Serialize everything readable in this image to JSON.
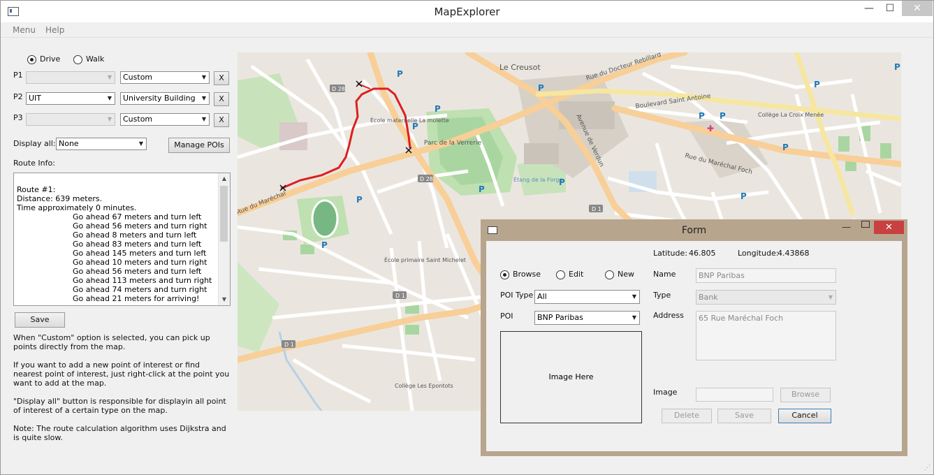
{
  "window": {
    "title": "MapExplorer",
    "minimize": "—",
    "maximize": "☐",
    "close": "✕"
  },
  "menubar": {
    "items": [
      "Menu",
      "Help"
    ]
  },
  "mode": {
    "options": [
      "Drive",
      "Walk"
    ],
    "selected": "Drive"
  },
  "points": [
    {
      "label": "P1",
      "place": "",
      "type": "Custom",
      "remove": "X"
    },
    {
      "label": "P2",
      "place": "UIT",
      "type": "University Building",
      "remove": "X"
    },
    {
      "label": "P3",
      "place": "",
      "type": "Custom",
      "remove": "X"
    }
  ],
  "display_all": {
    "label": "Display all:",
    "value": "None"
  },
  "manage_pois_label": "Manage POIs",
  "route_info": {
    "label": "Route Info:",
    "lines": [
      "Route #1:",
      "Distance: 639 meters.",
      "Time approximately 0 minutes.",
      "Go ahead 67 meters and turn left",
      "Go ahead 56 meters and turn right",
      "Go ahead 8 meters and turn left",
      "Go ahead 83 meters and turn left",
      "Go ahead 145 meters and turn left",
      "Go ahead 10 meters and turn right",
      "Go ahead 56 meters and turn left",
      "Go ahead 113 meters and turn right",
      "Go ahead 74 meters and turn right",
      "Go ahead 21 meters for arriving!"
    ]
  },
  "save_label": "Save",
  "help": [
    "When \"Custom\" option is selected, you can pick up points directly from the map.",
    "If you want to add a new point of interest or find nearest point of interest, just right-click at the point you want to add at the map.",
    " \"Display all\" button is responsible for displayin all point of interest of a certain type on the map.",
    "Note: The route calculation algorithm uses Dijkstra and is quite slow."
  ],
  "map_labels": {
    "le_creusot": "Le Creusot",
    "parc": "Parc de la Verrerie",
    "ecole_maternelle": "École maternelle La molette",
    "ecole_primaire": "École primaire Saint Michelet",
    "college_croix": "Collège La Croix Menée",
    "college_epontots": "Collège Les Epontots",
    "etang": "Étang de la Forge",
    "rue_marechal_foch": "Rue du Maréchal Foch",
    "rue_docteur": "Rue du Docteur Rebillard",
    "avenue_verdun": "Avenue de Verdun",
    "boulevard": "Boulevard Saint Antoine",
    "rue_marechal": "Rue du Maréchal",
    "road_d1": "D 1",
    "road_d28": "D 28",
    "parking": "P"
  },
  "form": {
    "title": "Form",
    "latitude_label": "Latitude:",
    "latitude": "46.805",
    "longitude_label": "Longitude:",
    "longitude": "4.43868",
    "modes": [
      "Browse",
      "Edit",
      "New"
    ],
    "selected_mode": "Browse",
    "poi_type_label": "POI Type",
    "poi_type": "All",
    "poi_label": "POI",
    "poi": "BNP Paribas",
    "image_placeholder": "Image Here",
    "name_label": "Name",
    "name": "BNP Paribas",
    "type_label": "Type",
    "type": "Bank",
    "address_label": "Address",
    "address": "65 Rue Maréchal Foch",
    "image_label": "Image",
    "browse_label": "Browse",
    "delete_label": "Delete",
    "save_label": "Save",
    "cancel_label": "Cancel"
  },
  "colors": {
    "route": "#dd1f1f",
    "map_major_road": "#f8cf98",
    "map_park": "#a9d6a0",
    "form_frame": "#b8a58e",
    "form_close": "#c94040"
  }
}
